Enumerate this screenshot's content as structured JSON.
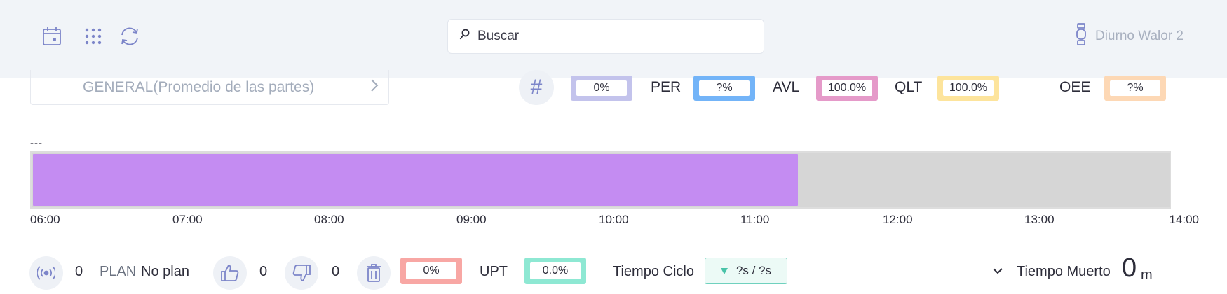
{
  "header": {
    "icons": [
      "calendar-icon",
      "apps-grid-icon",
      "refresh-icon"
    ],
    "search": {
      "placeholder": "Buscar",
      "value": ""
    },
    "user": {
      "label": "Diurno Walor 2",
      "icon": "watch-icon"
    }
  },
  "selector": {
    "label": "GENERAL(Promedio de las partes)",
    "icon": "chevron-right-icon"
  },
  "metrics": {
    "hash_symbol": "#",
    "count": {
      "value": "0%",
      "color": "#c3c3ec"
    },
    "per": {
      "label": "PER",
      "value": "?%",
      "color": "#73b4f8"
    },
    "avl": {
      "label": "AVL",
      "value": "100.0%",
      "color": "#e59ac9"
    },
    "qlt": {
      "label": "QLT",
      "value": "100.0%",
      "color": "#fde49c"
    },
    "oee": {
      "label": "OEE",
      "value": "?%",
      "color": "#fdd8b5"
    }
  },
  "timeline": {
    "caption": "---",
    "ticks": [
      "06:00",
      "07:00",
      "08:00",
      "09:00",
      "10:00",
      "11:00",
      "12:00",
      "13:00",
      "14:00"
    ],
    "progress": 0.674,
    "fill_color": "#c48cf2",
    "track_color": "#d6d6d6"
  },
  "bottom": {
    "signal_count": "0",
    "plan_label": "PLAN",
    "plan_value": "No plan",
    "good_count": "0",
    "bad_count": "0",
    "scrap_pct": {
      "value": "0%",
      "color": "#f8a7a4"
    },
    "upt": {
      "label": "UPT",
      "value": "0.0%",
      "color": "#8ee8d3"
    },
    "cycle": {
      "label": "Tiempo Ciclo",
      "value": "?s / ?s"
    },
    "dead_time": {
      "label": "Tiempo Muerto",
      "value": "0",
      "unit": "m"
    }
  }
}
